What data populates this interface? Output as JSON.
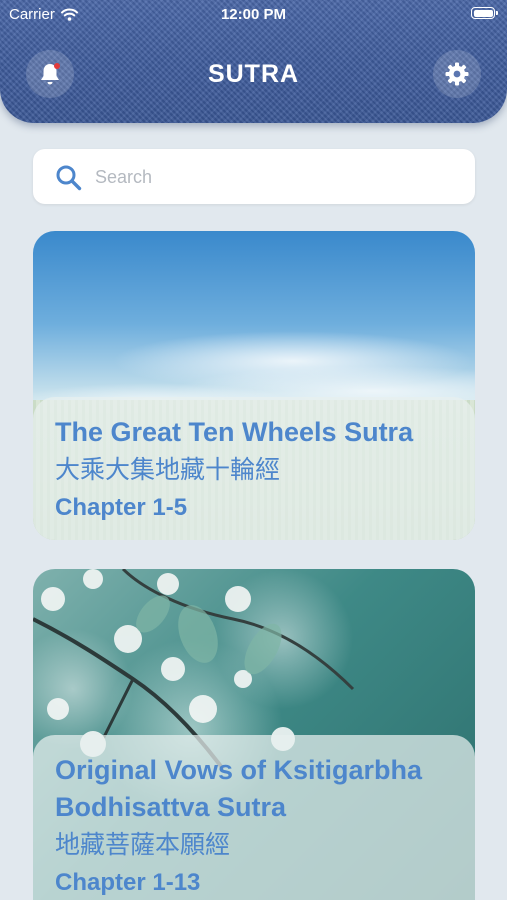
{
  "status_bar": {
    "carrier": "Carrier",
    "time": "12:00 PM"
  },
  "header": {
    "title": "SUTRA",
    "bell_icon": "bell-icon",
    "settings_icon": "gear-icon",
    "notification_color": "#e23a3a"
  },
  "search": {
    "placeholder": "Search"
  },
  "cards": [
    {
      "title_en": "The Great Ten Wheels Sutra",
      "title_zh": "大乘大集地藏十輪經",
      "chapters": "Chapter 1-5",
      "image": "sky-and-field"
    },
    {
      "title_en_line1": "Original Vows of Ksitigarbha",
      "title_en_line2": "Bodhisattva Sutra",
      "title_zh": "地藏菩薩本願經",
      "chapters": "Chapter 1-13",
      "image": "cherry-blossom-branch"
    }
  ],
  "colors": {
    "accent": "#4d86cc",
    "header": "#3f5d9e",
    "background": "#e1e8ee"
  }
}
